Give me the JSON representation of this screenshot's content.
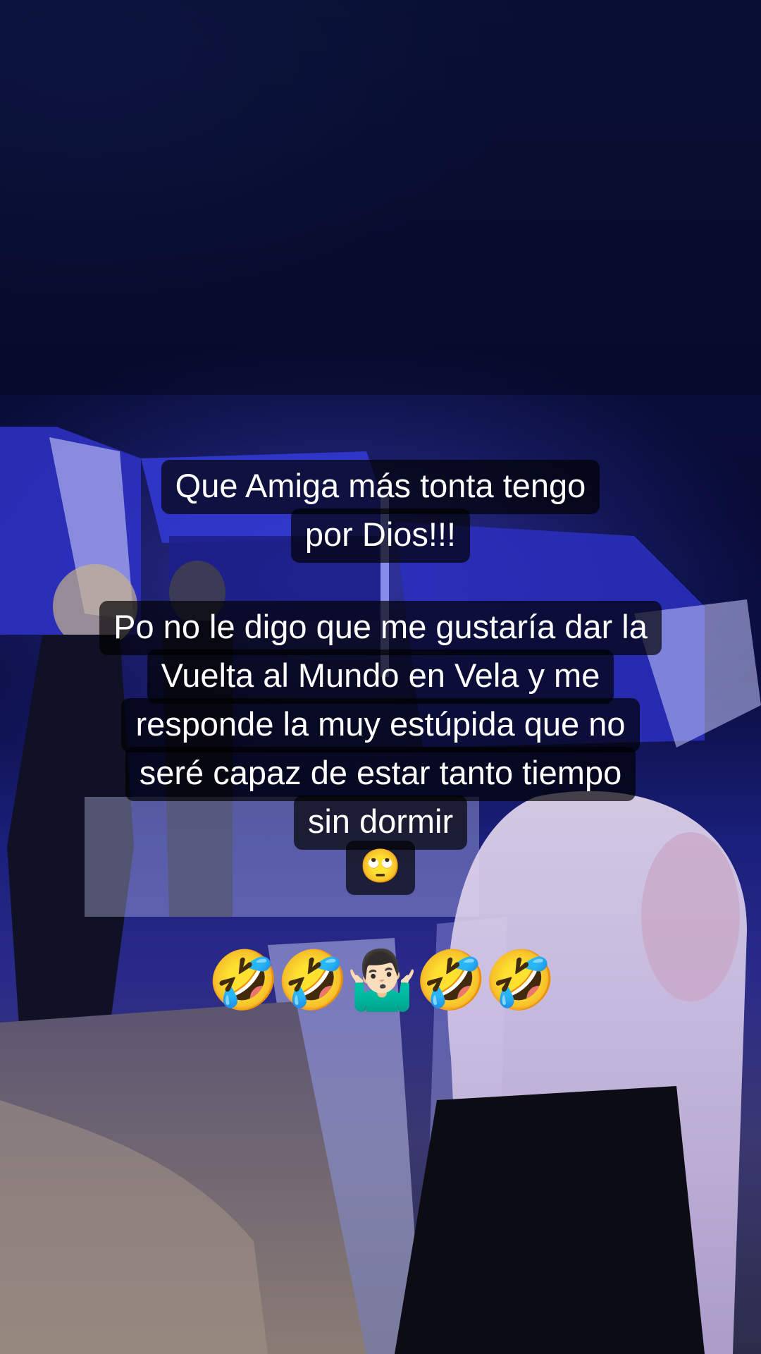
{
  "caption": {
    "lines": [
      "Que Amiga más tonta tengo",
      "por Dios!!!",
      "Po no le digo que me gustaría dar la",
      "Vuelta al Mundo en Vela y me",
      "responde la muy estúpida que no",
      "seré capaz de estar tanto tiempo",
      "sin dormir",
      "🙄"
    ],
    "emoji_line": "🤣🤣🤷🏻‍♂️🤣🤣"
  },
  "background": {
    "description_colors": {
      "sky": "#0b1240",
      "light": "#3a3cd8",
      "sand": "#8a7c74"
    }
  }
}
